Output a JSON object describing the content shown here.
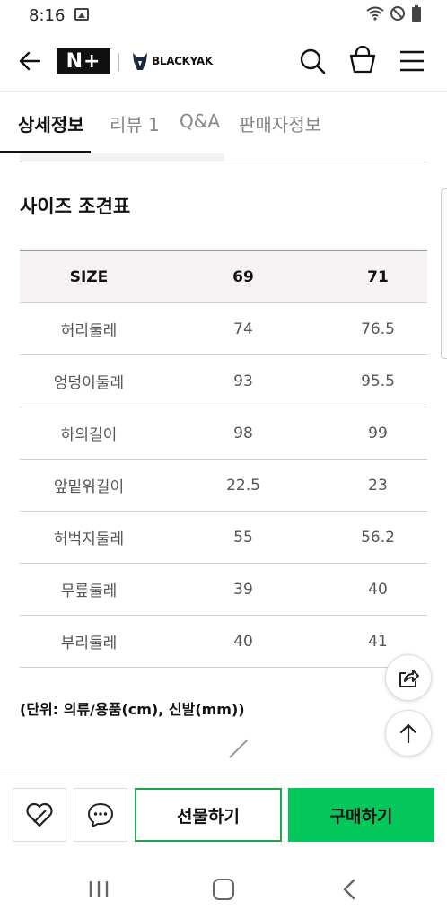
{
  "status_bar": {
    "time": "8:16"
  },
  "header": {
    "brand_logo": "N+",
    "store_logo": "BLACKYAK",
    "icons": [
      "back-arrow-icon",
      "search-icon",
      "shopping-bag-icon",
      "menu-icon"
    ]
  },
  "tabs": [
    {
      "label": "상세정보",
      "active": true
    },
    {
      "label": "리뷰 1",
      "active": false
    },
    {
      "label": "Q&A",
      "active": false
    },
    {
      "label": "판매자정보",
      "active": false
    }
  ],
  "size_chart": {
    "title": "사이즈 조견표",
    "headers": [
      "SIZE",
      "69",
      "71"
    ],
    "rows": [
      [
        "허리둘레",
        "74",
        "76.5"
      ],
      [
        "엉덩이둘레",
        "93",
        "95.5"
      ],
      [
        "하의길이",
        "98",
        "99"
      ],
      [
        "앞밑위길이",
        "22.5",
        "23"
      ],
      [
        "허벅지둘레",
        "55",
        "56.2"
      ],
      [
        "무릎둘레",
        "39",
        "40"
      ],
      [
        "부리둘레",
        "40",
        "41"
      ]
    ],
    "unit_note": "(단위: 의류/용품(cm), 신발(mm))"
  },
  "floating": {
    "share_icon": "share-icon",
    "top_icon": "arrow-up-icon"
  },
  "bottom_bar": {
    "gift_label": "선물하기",
    "buy_label": "구매하기",
    "accent_green": "#03c75a"
  }
}
